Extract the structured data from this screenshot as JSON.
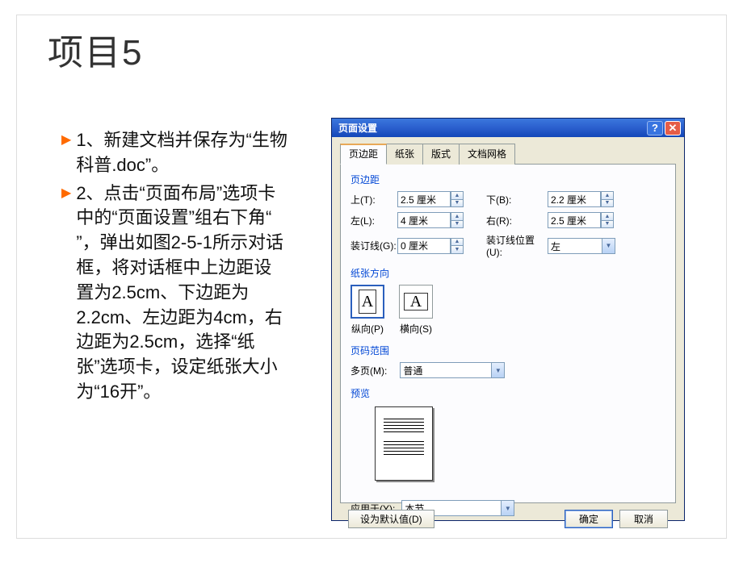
{
  "title": "项目5",
  "bullets": [
    "1、新建文档并保存为“生物科普.doc”。",
    "2、点击“页面布局”选项卡中的“页面设置”组右下角“ ”，弹出如图2-5-1所示对话框，将对话框中上边距设置为2.5cm、下边距为2.2cm、左边距为4cm，右边距为2.5cm，选择“纸张”选项卡，设定纸张大小为“16开”。"
  ],
  "dialog": {
    "title": "页面设置",
    "tabs": [
      "页边距",
      "纸张",
      "版式",
      "文档网格"
    ],
    "activeTab": 0,
    "margins": {
      "group": "页边距",
      "top": {
        "label": "上(T):",
        "value": "2.5 厘米"
      },
      "bottom": {
        "label": "下(B):",
        "value": "2.2 厘米"
      },
      "left": {
        "label": "左(L):",
        "value": "4 厘米"
      },
      "right": {
        "label": "右(R):",
        "value": "2.5 厘米"
      },
      "gutter": {
        "label": "装订线(G):",
        "value": "0 厘米"
      },
      "gutterPos": {
        "label": "装订线位置(U):",
        "value": "左"
      }
    },
    "orientation": {
      "group": "纸张方向",
      "portrait": "纵向(P)",
      "landscape": "横向(S)"
    },
    "pages": {
      "group": "页码范围",
      "multi": {
        "label": "多页(M):",
        "value": "普通"
      }
    },
    "preview": {
      "group": "预览"
    },
    "apply": {
      "label": "应用于(Y):",
      "value": "本节"
    },
    "buttons": {
      "default": "设为默认值(D)",
      "ok": "确定",
      "cancel": "取消"
    }
  }
}
